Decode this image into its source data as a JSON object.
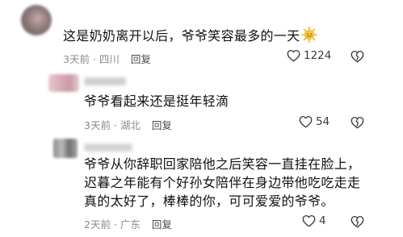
{
  "comments": [
    {
      "text_lines": [
        "这是奶奶离开以后，爷爷笑容最多的一天"
      ],
      "emoji_icon": "smiling-sun-icon",
      "time": "3天前",
      "location": "四川",
      "reply_label": "回复",
      "likes": "1224"
    },
    {
      "text_lines": [
        "爷爷看起来还是挺年轻滴"
      ],
      "time": "3天前",
      "location": "湖北",
      "reply_label": "回复",
      "likes": "54"
    },
    {
      "text_lines": [
        "爷爷从你辞职回家陪他之后笑容一直挂在脸上，",
        "迟暮之年能有个好孙女陪伴在身边带他吃吃走走",
        "真的太好了，棒棒的你，可可爱爱的爷爷。"
      ],
      "time": "2天前",
      "location": "广东",
      "reply_label": "回复",
      "likes": "4"
    }
  ],
  "meta_separator": " · ",
  "colors": {
    "text": "#111111",
    "meta": "#8a8a8a",
    "reply": "#4a4a4a",
    "icon": "#3c3c3c"
  }
}
